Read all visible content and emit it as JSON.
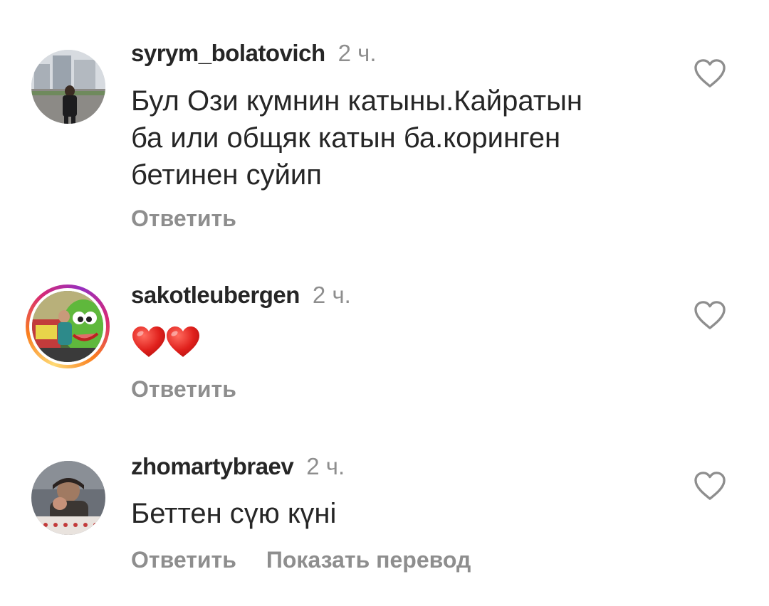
{
  "comments": [
    {
      "username": "syrym_bolatovich",
      "time": "2 ч.",
      "text_lines": [
        "Бул Ози кумнин катыны.Кайратын",
        "ба или общяк катын ба.коринген",
        "бетинен суйип"
      ],
      "reply_label": "Ответить",
      "has_story_ring": false
    },
    {
      "username": "sakotleubergen",
      "time": "2 ч.",
      "text_emoji": "❤❤",
      "reply_label": "Ответить",
      "has_story_ring": true
    },
    {
      "username": "zhomartybraev",
      "time": "2 ч.",
      "text_lines": [
        "Беттен сүю күні"
      ],
      "reply_label": "Ответить",
      "translate_label": "Показать перевод",
      "has_story_ring": false
    }
  ],
  "colors": {
    "text_primary": "#262626",
    "text_secondary": "#8e8e8e",
    "heart_emoji": "#e0201c"
  },
  "icons": {
    "like": "heart-outline-icon",
    "emoji": "red-heart-emoji"
  }
}
